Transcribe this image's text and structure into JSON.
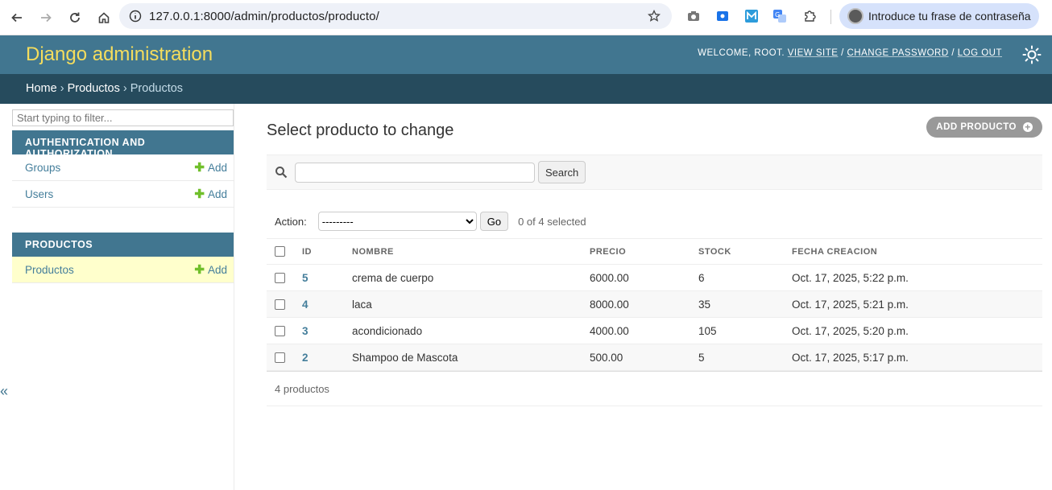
{
  "browser": {
    "url": "127.0.0.1:8000/admin/productos/producto/",
    "profile_label": "Introduce tu frase de contraseña"
  },
  "header": {
    "brand": "Django administration",
    "welcome": "WELCOME, ROOT.",
    "view_site": "VIEW SITE",
    "change_password": "CHANGE PASSWORD",
    "log_out": "LOG OUT"
  },
  "breadcrumbs": {
    "home": "Home",
    "app": "Productos",
    "current": "Productos"
  },
  "sidebar": {
    "filter_placeholder": "Start typing to filter...",
    "toggle": "«",
    "modules": [
      {
        "caption": "AUTHENTICATION AND AUTHORIZATION",
        "rows": [
          {
            "label": "Groups",
            "add": "Add"
          },
          {
            "label": "Users",
            "add": "Add"
          }
        ]
      },
      {
        "caption": "PRODUCTOS",
        "rows": [
          {
            "label": "Productos",
            "add": "Add"
          }
        ]
      }
    ]
  },
  "main": {
    "title": "Select producto to change",
    "add_button": "ADD PRODUCTO",
    "search_button": "Search",
    "action_label": "Action:",
    "action_selected": "---------",
    "go_button": "Go",
    "selected_count": "0 of 4 selected",
    "columns": [
      "ID",
      "NOMBRE",
      "PRECIO",
      "STOCK",
      "FECHA CREACION"
    ],
    "rows": [
      {
        "id": "5",
        "nombre": "crema de cuerpo",
        "precio": "6000.00",
        "stock": "6",
        "fecha": "Oct. 17, 2025, 5:22 p.m."
      },
      {
        "id": "4",
        "nombre": "laca",
        "precio": "8000.00",
        "stock": "35",
        "fecha": "Oct. 17, 2025, 5:21 p.m."
      },
      {
        "id": "3",
        "nombre": "acondicionado",
        "precio": "4000.00",
        "stock": "105",
        "fecha": "Oct. 17, 2025, 5:20 p.m."
      },
      {
        "id": "2",
        "nombre": "Shampoo de Mascota",
        "precio": "500.00",
        "stock": "5",
        "fecha": "Oct. 17, 2025, 5:17 p.m."
      }
    ],
    "paginator": "4 productos"
  },
  "colors": {
    "header_bg": "#417690",
    "breadcrumb_bg": "#264b5d",
    "brand_yellow": "#f5dd5d",
    "link": "#447e9b",
    "add_green": "#70bf2b",
    "current_row_bg": "#ffffcc"
  }
}
